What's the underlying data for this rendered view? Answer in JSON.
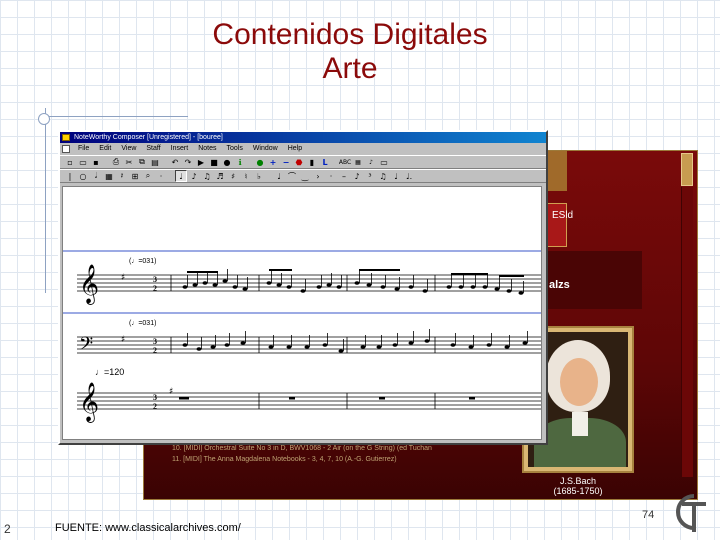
{
  "slide": {
    "title_line1": "Contenidos Digitales",
    "title_line2": "Arte",
    "slide_number": "2",
    "source": "FUENTE: www.classicalarchives.com/",
    "page_number": "74",
    "logo_letters": "GT"
  },
  "window": {
    "title": "NoteWorthy Composer [Unregistered] - [bouree]",
    "menu": [
      "File",
      "Edit",
      "View",
      "Staff",
      "Insert",
      "Notes",
      "Tools",
      "Window",
      "Help"
    ],
    "toolbar1_icons": [
      "new-file-icon",
      "open-icon",
      "save-icon",
      "print-icon",
      "cut-icon",
      "copy-icon",
      "paste-icon",
      "undo-icon",
      "redo-icon",
      "play-icon",
      "stop-icon",
      "record-icon",
      "info-icon",
      "add-staff-icon",
      "remove-staff-icon",
      "stop-sign-icon",
      "text-icon",
      "lyrics-icon",
      "abc-icon",
      "page-icon",
      "keyboard-icon"
    ],
    "toolbar2_icons": [
      "note-icon",
      "sharp-icon",
      "natural-icon",
      "flat-icon",
      "sixteenth-icon",
      "dotted-icon",
      "pointer-icon"
    ]
  },
  "score": {
    "staff1_tempo": "(♩=031)",
    "staff2_tempo": "(♩=031)",
    "tempo_marking": "♩=120",
    "treble_clef": "𝄞",
    "bass_clef": "𝄢",
    "time_sig_top": "3",
    "time_sig_bottom": "2"
  },
  "background_site": {
    "band_text": "alzs",
    "tab_text": "ESld",
    "composer_name": "J.S.Bach",
    "composer_dates": "(1685-1750)",
    "list": [
      "10. [MIDI] Orchestral Suite No 3 in D, BWV1068 - 2 Air (on the G String) (ed Tuchanov)",
      "11. [MIDI] The Anna Magdalena Notebooks - 3, 4, 7, 10 (A.-G. Gutierrez)"
    ]
  },
  "colors": {
    "title": "#8b0a0a",
    "site_red": "#7a0a0a",
    "window_titlebar": "#00007c"
  }
}
